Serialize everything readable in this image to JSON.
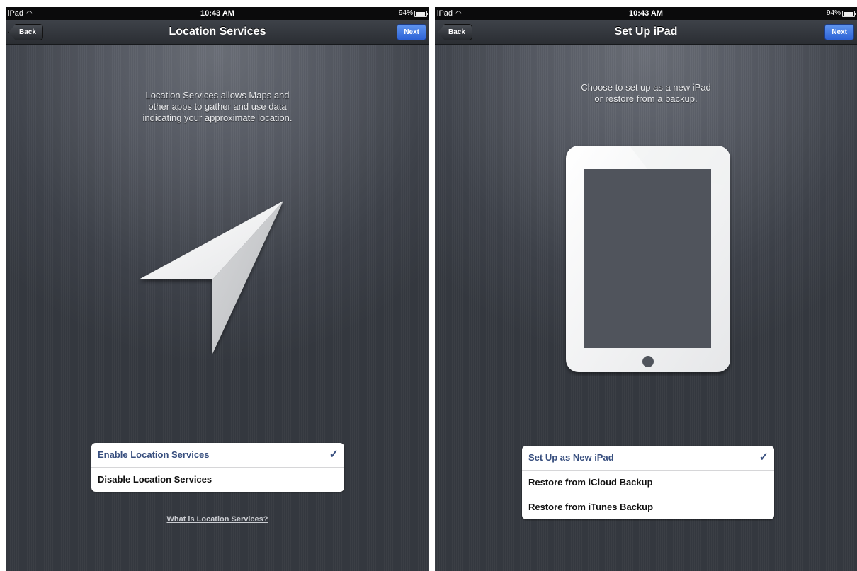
{
  "screens": [
    {
      "status": {
        "carrier": "iPad",
        "wifi_icon": "wifi-icon",
        "time": "10:43 AM",
        "battery": "94%"
      },
      "nav": {
        "back": "Back",
        "title": "Location Services",
        "next": "Next"
      },
      "intro": "Location Services allows Maps and\nother apps to gather and use data\nindicating your approximate location.",
      "illustration": "location-arrow-icon",
      "options": [
        {
          "label": "Enable Location Services",
          "selected": true
        },
        {
          "label": "Disable Location Services",
          "selected": false
        }
      ],
      "check_mark": "✓",
      "help_link": "What is Location Services?"
    },
    {
      "status": {
        "carrier": "iPad",
        "wifi_icon": "wifi-icon",
        "time": "10:43 AM",
        "battery": "94%"
      },
      "nav": {
        "back": "Back",
        "title": "Set Up iPad",
        "next": "Next"
      },
      "intro": "Choose to set up as a new iPad\nor restore from a backup.",
      "illustration": "ipad-icon",
      "options": [
        {
          "label": "Set Up as New iPad",
          "selected": true
        },
        {
          "label": "Restore from iCloud Backup",
          "selected": false
        },
        {
          "label": "Restore from iTunes Backup",
          "selected": false
        }
      ],
      "check_mark": "✓"
    }
  ],
  "colors": {
    "accent_blue": "#2d62d6",
    "selected_text": "#384f7f",
    "background": "#4a4e56"
  }
}
